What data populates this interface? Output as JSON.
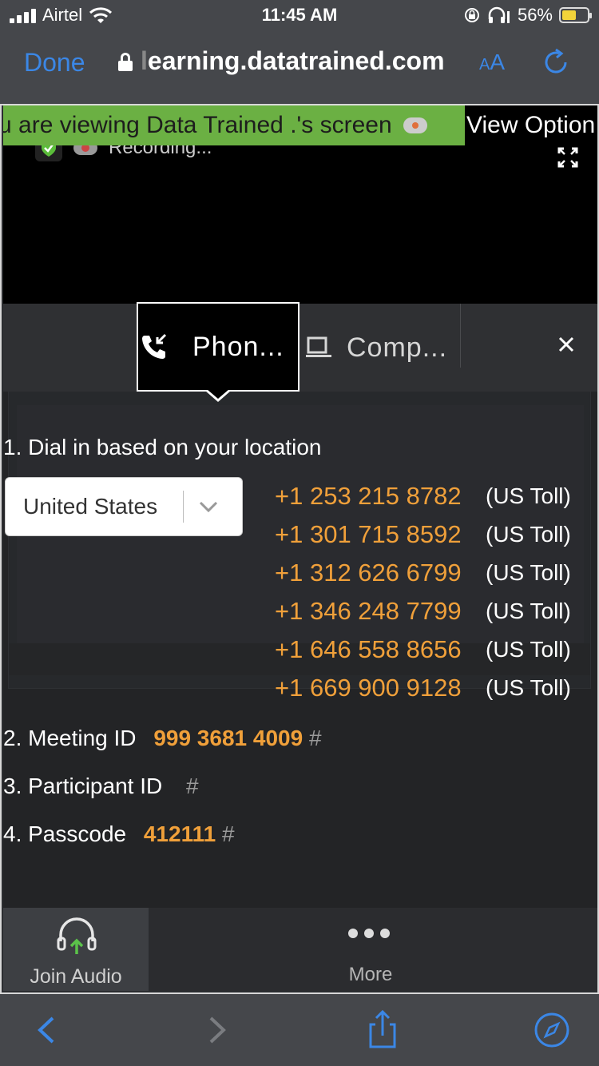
{
  "status_bar": {
    "carrier": "Airtel",
    "time": "11:45 AM",
    "battery_percent": "56%",
    "battery_level": 0.56,
    "icons": [
      "signal-icon",
      "wifi-icon",
      "orientation-lock-icon",
      "headphones-icon",
      "battery-icon"
    ]
  },
  "browser": {
    "done_label": "Done",
    "url": "earning.datatrained.com",
    "url_prefix_faded": "l",
    "text_size_label_small": "A",
    "text_size_label_large": "A",
    "icons": [
      "lock-icon",
      "reload-icon",
      "back-icon",
      "forward-icon",
      "share-icon",
      "compass-icon"
    ]
  },
  "meeting": {
    "share_banner": "u are viewing Data Trained .'s screen",
    "view_options": "View Option",
    "recording_label": "Recording...",
    "tabs": {
      "phone": "Phon...",
      "computer": "Comp..."
    },
    "dial_in": {
      "step1": "1. Dial in based on your location",
      "country": "United States",
      "numbers": [
        {
          "number": "+1 253 215 8782",
          "type": "(US Toll)"
        },
        {
          "number": "+1 301 715 8592",
          "type": "(US Toll)"
        },
        {
          "number": "+1 312 626 6799",
          "type": "(US Toll)"
        },
        {
          "number": "+1 346 248 7799",
          "type": "(US Toll)"
        },
        {
          "number": "+1 646 558 8656",
          "type": "(US Toll)"
        },
        {
          "number": "+1 669 900 9128",
          "type": "(US Toll)"
        }
      ],
      "step2_label": "2. Meeting ID",
      "meeting_id": "999 3681 4009",
      "step3_label": "3. Participant ID",
      "step4_label": "4. Passcode",
      "passcode": "412111",
      "hash": "#"
    },
    "toolbar": {
      "join_audio": "Join Audio",
      "more": "More"
    }
  },
  "colors": {
    "accent_blue": "#3b87e6",
    "banner_green": "#6bb043",
    "number_orange": "#f0a03a",
    "battery_yellow": "#f2d33a"
  }
}
